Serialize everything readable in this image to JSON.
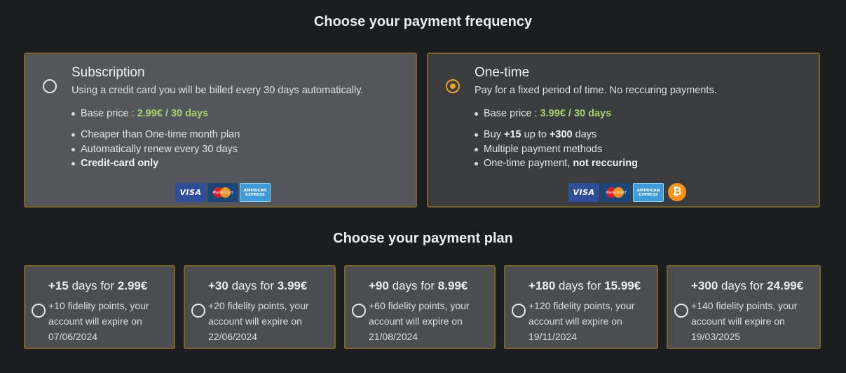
{
  "frequency": {
    "title": "Choose your payment frequency",
    "subscription": {
      "title": "Subscription",
      "description": "Using a credit card you will be billed every 30 days automatically.",
      "price_label": "Base price : ",
      "price_value": "2.99€ / 30 days",
      "features": [
        "Cheaper than One-time month plan",
        "Automatically renew every 30 days"
      ],
      "last_feature": "Credit-card only",
      "selected": false,
      "logos": [
        "VISA",
        "MasterCard",
        "AMERICAN EXPRESS"
      ]
    },
    "onetime": {
      "title": "One-time",
      "description": "Pay for a fixed period of time. No reccuring payments.",
      "price_label": "Base price : ",
      "price_value": "3.99€ / 30 days",
      "buy_prefix": "Buy ",
      "buy_min": "+15",
      "buy_mid": " up to ",
      "buy_max": "+300",
      "buy_suffix": " days",
      "feature_methods": "Multiple payment methods",
      "onetime_prefix": "One-time payment, ",
      "onetime_bold": "not reccuring",
      "selected": true,
      "logos": [
        "VISA",
        "MasterCard",
        "AMERICAN EXPRESS",
        "₿"
      ]
    }
  },
  "plans": {
    "title": "Choose your payment plan",
    "items": [
      {
        "days": "+15",
        "mid": " days for ",
        "price": "2.99€",
        "line1": "+10 fidelity points, your",
        "line2": "account will expire on",
        "date": "07/06/2024"
      },
      {
        "days": "+30",
        "mid": " days for ",
        "price": "3.99€",
        "line1": "+20 fidelity points, your",
        "line2": "account will expire on",
        "date": "22/06/2024"
      },
      {
        "days": "+90",
        "mid": " days for ",
        "price": "8.99€",
        "line1": "+60 fidelity points, your",
        "line2": "account will expire on",
        "date": "21/08/2024"
      },
      {
        "days": "+180",
        "mid": " days for ",
        "price": "15.99€",
        "line1": "+120 fidelity points, your",
        "line2": "account will expire on",
        "date": "19/11/2024"
      },
      {
        "days": "+300",
        "mid": " days for ",
        "price": "24.99€",
        "line1": "+140 fidelity points, your",
        "line2": "account will expire on",
        "date": "19/03/2025"
      }
    ]
  },
  "colors": {
    "accent": "#e8a42a",
    "price_green": "#a5d36b",
    "border": "#7a6424"
  }
}
